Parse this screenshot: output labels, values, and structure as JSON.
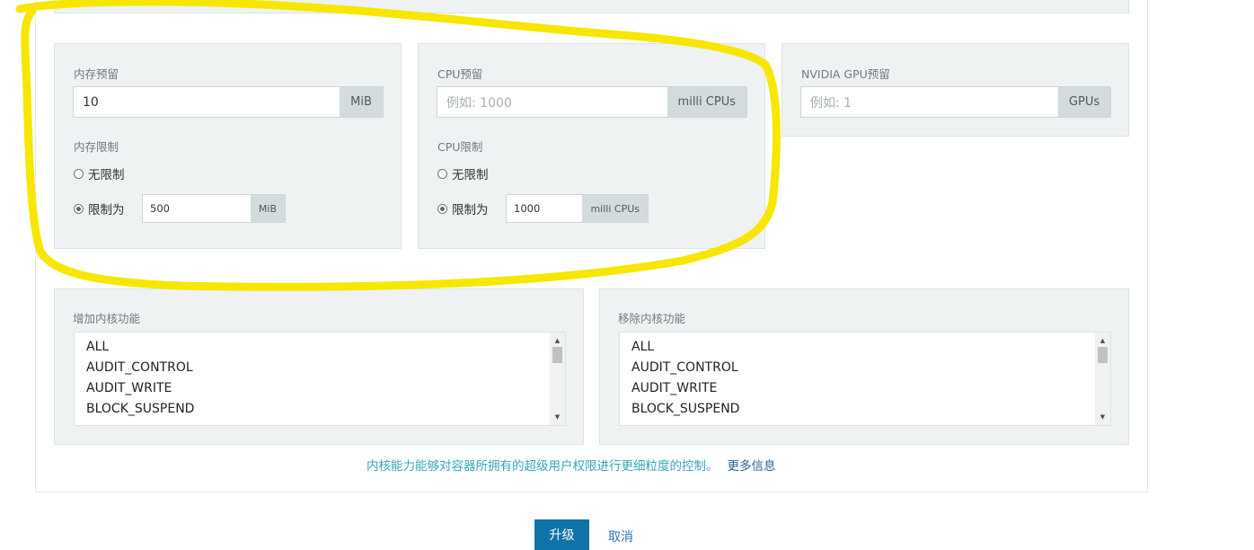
{
  "memory": {
    "reservation_label": "内存预留",
    "reservation_value": "10",
    "reservation_unit": "MiB",
    "limit_label": "内存限制",
    "unlimited_label": "无限制",
    "limit_to_label": "限制为",
    "limit_value": "500",
    "limit_unit": "MiB"
  },
  "cpu": {
    "reservation_label": "CPU预留",
    "reservation_placeholder": "例如: 1000",
    "reservation_unit": "milli CPUs",
    "limit_label": "CPU限制",
    "unlimited_label": "无限制",
    "limit_to_label": "限制为",
    "limit_value": "1000",
    "limit_unit": "milli CPUs"
  },
  "gpu": {
    "reservation_label": "NVIDIA GPU预留",
    "reservation_placeholder": "例如: 1",
    "reservation_unit": "GPUs"
  },
  "cap_add": {
    "label": "增加内核功能",
    "items": [
      "ALL",
      "AUDIT_CONTROL",
      "AUDIT_WRITE",
      "BLOCK_SUSPEND"
    ]
  },
  "cap_drop": {
    "label": "移除内核功能",
    "items": [
      "ALL",
      "AUDIT_CONTROL",
      "AUDIT_WRITE",
      "BLOCK_SUSPEND"
    ]
  },
  "help": {
    "text": "内核能力能够对容器所拥有的超级用户权限进行更细粒度的控制。",
    "link": "更多信息"
  },
  "actions": {
    "upgrade": "升级",
    "cancel": "取消"
  },
  "colors": {
    "annotation": "#f7e600",
    "primary": "#0f74a9",
    "panel": "#eef2f2"
  }
}
